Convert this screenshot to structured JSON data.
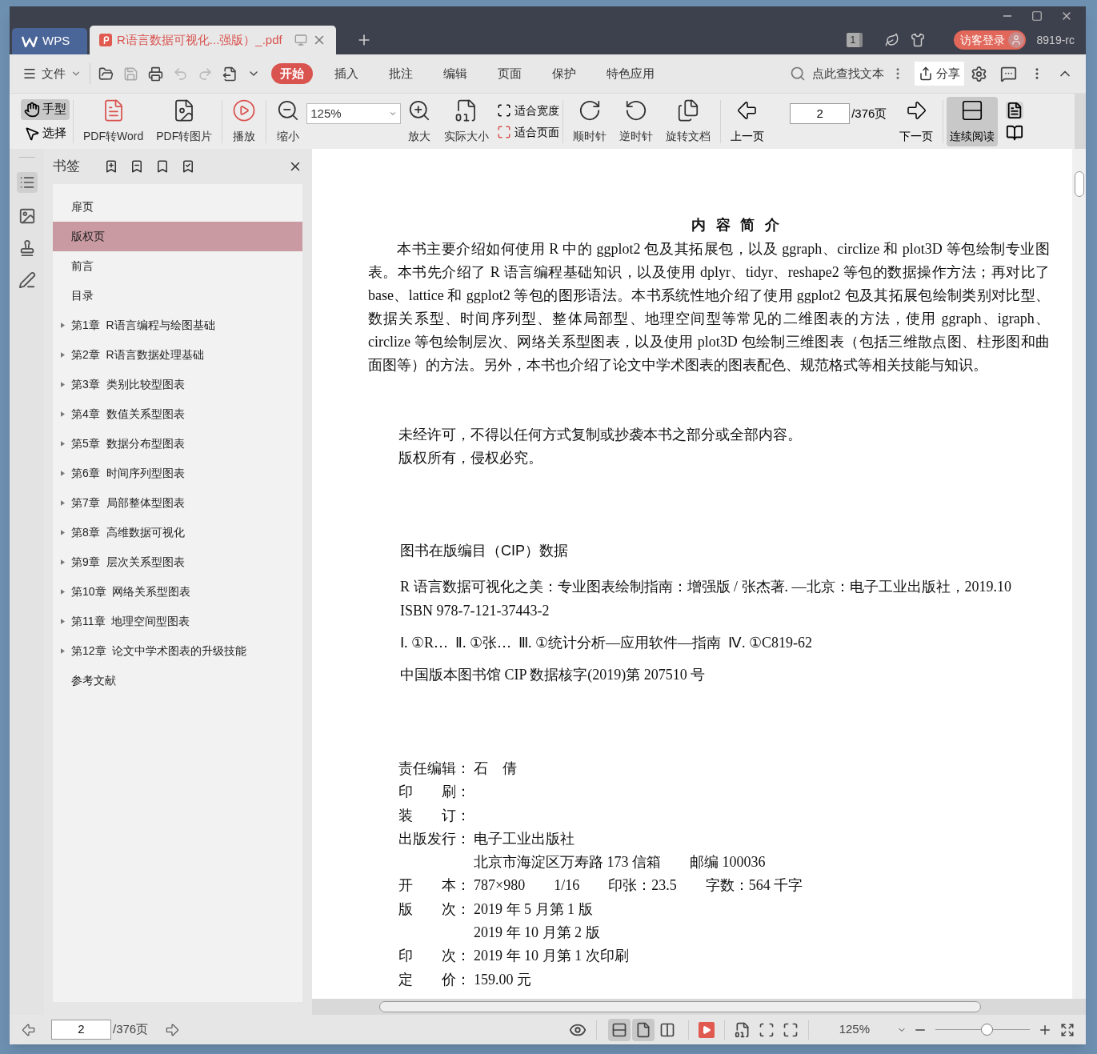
{
  "tabs": [
    {
      "kind": "home",
      "label": "WPS",
      "selected": false
    },
    {
      "kind": "document",
      "label": "R语言数据可视化...强版）_.pdf",
      "selected": true
    }
  ],
  "title_bar": {
    "window_count": "1",
    "login": "访客登录",
    "account": "8919-rc"
  },
  "menu": {
    "file": "文件",
    "tabs": [
      {
        "label": "开始",
        "selected": true
      },
      {
        "label": "插入",
        "selected": false
      },
      {
        "label": "批注",
        "selected": false
      },
      {
        "label": "编辑",
        "selected": false
      },
      {
        "label": "页面",
        "selected": false
      },
      {
        "label": "保护",
        "selected": false
      },
      {
        "label": "特色应用",
        "selected": false
      }
    ],
    "search": "点此查找文本",
    "share": "分享"
  },
  "toolbar": {
    "modes": [
      {
        "kind": "hand",
        "label": "手型",
        "selected": true
      },
      {
        "kind": "select",
        "label": "选择",
        "selected": false
      }
    ],
    "convert": [
      {
        "kind": "word",
        "label": "PDF转Word"
      },
      {
        "kind": "image",
        "label": "PDF转图片"
      },
      {
        "kind": "play",
        "label": "播放"
      },
      {
        "kind": "zoom_out",
        "label": "缩小"
      }
    ],
    "zoom_value": "125%",
    "sizing": [
      {
        "kind": "zoom_in",
        "label": "放大"
      },
      {
        "kind": "actual",
        "label": "实际大小"
      }
    ],
    "fit": [
      {
        "kind": "width",
        "label": "适合宽度"
      },
      {
        "kind": "page",
        "label": "适合页面"
      }
    ],
    "rotate": [
      {
        "kind": "cw",
        "label": "顺时针"
      },
      {
        "kind": "ccw",
        "label": "逆时针"
      },
      {
        "kind": "doc",
        "label": "旋转文档"
      }
    ],
    "prev": "上一页",
    "page": "2",
    "total": "/376页",
    "next": "下一页",
    "continuous": {
      "label": "连续阅读",
      "selected": true
    }
  },
  "sidebar": {
    "title": "书签",
    "items": [
      {
        "label": "扉页",
        "expandable": false,
        "selected": false
      },
      {
        "label": "版权页",
        "expandable": false,
        "selected": true
      },
      {
        "label": "前言",
        "expandable": false,
        "selected": false
      },
      {
        "label": "目录",
        "expandable": false,
        "selected": false
      },
      {
        "label": "第1章  R语言编程与绘图基础",
        "expandable": true,
        "selected": false
      },
      {
        "label": "第2章  R语言数据处理基础",
        "expandable": true,
        "selected": false
      },
      {
        "label": "第3章  类别比较型图表",
        "expandable": true,
        "selected": false
      },
      {
        "label": "第4章  数值关系型图表",
        "expandable": true,
        "selected": false
      },
      {
        "label": "第5章  数据分布型图表",
        "expandable": true,
        "selected": false
      },
      {
        "label": "第6章  时间序列型图表",
        "expandable": true,
        "selected": false
      },
      {
        "label": "第7章  局部整体型图表",
        "expandable": true,
        "selected": false
      },
      {
        "label": "第8章  高维数据可视化",
        "expandable": true,
        "selected": false
      },
      {
        "label": "第9章  层次关系型图表",
        "expandable": true,
        "selected": false
      },
      {
        "label": "第10章  网络关系型图表",
        "expandable": true,
        "selected": false
      },
      {
        "label": "第11章  地理空间型图表",
        "expandable": true,
        "selected": false
      },
      {
        "label": "第12章  论文中学术图表的升级技能",
        "expandable": true,
        "selected": false
      },
      {
        "label": "参考文献",
        "expandable": false,
        "selected": false
      }
    ]
  },
  "document": {
    "heading": "内 容 简 介",
    "summary": "本书主要介绍如何使用 R 中的 ggplot2 包及其拓展包，以及 ggraph、circlize 和 plot3D 等包绘制专业图表。本书先介绍了 R 语言编程基础知识，以及使用 dplyr、tidyr、reshape2 等包的数据操作方法；再对比了 base、lattice 和 ggplot2 等包的图形语法。本书系统性地介绍了使用 ggplot2 包及其拓展包绘制类别对比型、数据关系型、时间序列型、整体局部型、地理空间型等常见的二维图表的方法，使用 ggraph、igraph、circlize 等包绘制层次、网络关系型图表，以及使用 plot3D 包绘制三维图表（包括三维散点图、柱形图和曲面图等）的方法。另外，本书也介绍了论文中学术图表的图表配色、规范格式等相关技能与知识。",
    "notice": [
      "未经许可，不得以任何方式复制或抄袭本书之部分或全部内容。",
      "版权所有，侵权必究。"
    ],
    "cip_title": "图书在版编目（CIP）数据",
    "cip_lines": [
      "R 语言数据可视化之美：专业图表绘制指南：增强版 / 张杰著. —北京：电子工业出版社，2019.10",
      "ISBN 978-7-121-37443-2",
      "Ⅰ. ①R…  Ⅱ. ①张…  Ⅲ. ①统计分析—应用软件—指南  Ⅳ. ①C819-62",
      "中国版本图书馆 CIP 数据核字(2019)第 207510 号"
    ],
    "credits": [
      {
        "label": "责任编辑：",
        "value": "石　倩"
      },
      {
        "label": "印　　刷："
      },
      {
        "label": "装　　订："
      },
      {
        "label": "出版发行：",
        "value": "电子工业出版社"
      },
      {
        "value": "北京市海淀区万寿路 173 信箱　　邮编 100036"
      },
      {
        "label": "开　　本：",
        "value": "787×980　　1/16　　印张：23.5　　字数：564 千字"
      },
      {
        "label": "版　　次：",
        "value": "2019 年 5 月第 1 版"
      },
      {
        "value": "2019 年 10 月第 2 版"
      },
      {
        "label": "印　　次：",
        "value": "2019 年 10 月第 1 次印刷"
      },
      {
        "label": "定　　价：",
        "value": "159.00 元"
      }
    ]
  },
  "status_bar": {
    "page": "2",
    "total": "/376页",
    "views": [
      {
        "kind": "continuous",
        "selected": true
      },
      {
        "kind": "single",
        "selected": true
      },
      {
        "kind": "double",
        "selected": false
      }
    ],
    "zoom": "125%",
    "level": 0.54
  }
}
